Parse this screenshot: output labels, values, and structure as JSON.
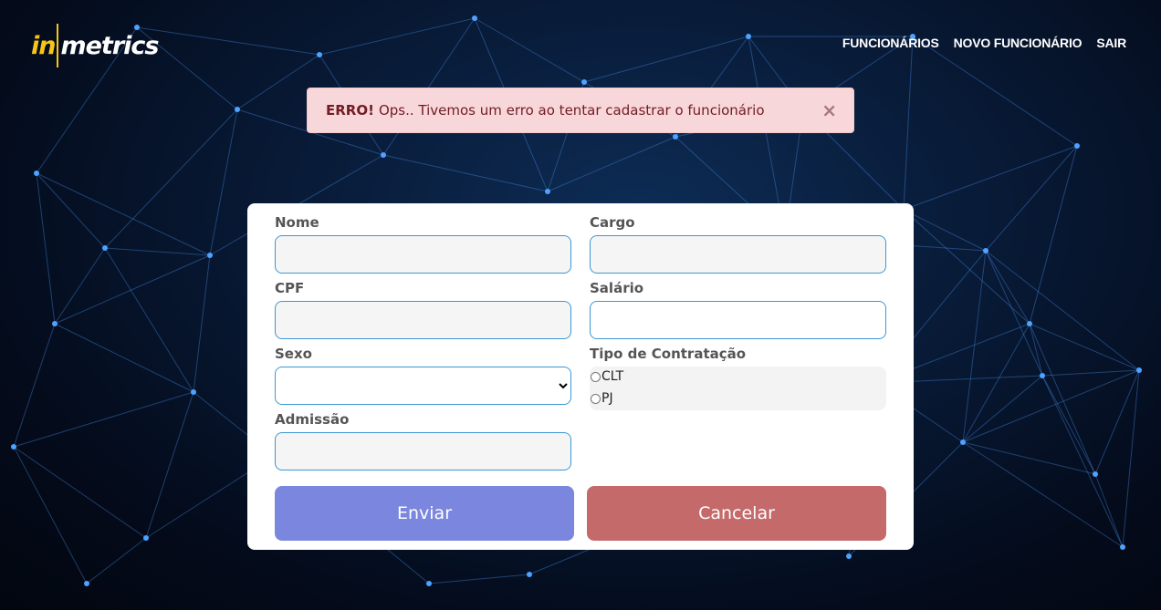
{
  "brand": {
    "logo_in": "in",
    "logo_metrics": "metrics"
  },
  "nav": {
    "items": [
      "FUNCIONÁRIOS",
      "NOVO FUNCIONÁRIO",
      "SAIR"
    ]
  },
  "alert": {
    "title": "ERRO!",
    "message": "Ops.. Tivemos um erro ao tentar cadastrar o funcionário",
    "close": "×",
    "color": "#f8d7da"
  },
  "form": {
    "nome": {
      "label": "Nome",
      "value": ""
    },
    "cargo": {
      "label": "Cargo",
      "value": ""
    },
    "cpf": {
      "label": "CPF",
      "value": ""
    },
    "salario": {
      "label": "Salário",
      "value": ""
    },
    "sexo": {
      "label": "Sexo",
      "selected": ""
    },
    "tipo": {
      "label": "Tipo de Contratação",
      "options": [
        "CLT",
        "PJ"
      ]
    },
    "admissao": {
      "label": "Admissão",
      "value": ""
    }
  },
  "buttons": {
    "send": "Enviar",
    "cancel": "Cancelar",
    "send_color": "#7b86de",
    "cancel_color": "#c46a6a"
  }
}
